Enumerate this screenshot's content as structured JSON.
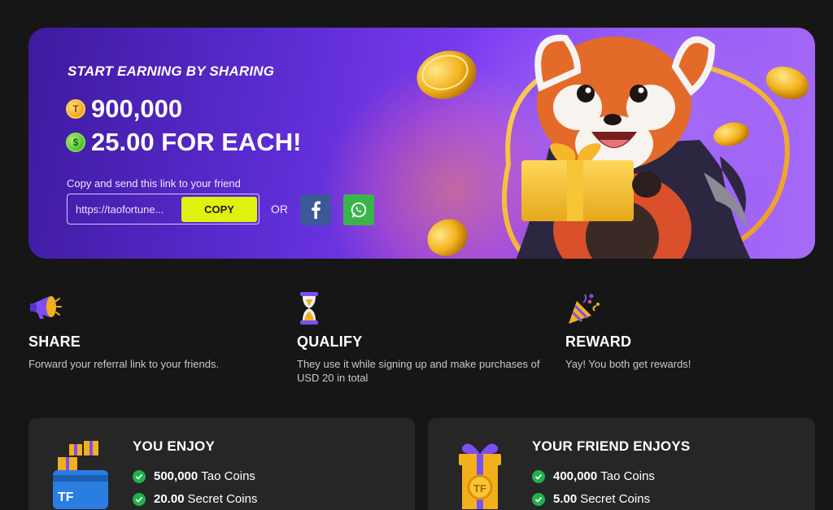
{
  "banner": {
    "title": "START EARNING BY SHARING",
    "amount_1": "900,000",
    "amount_2": "25.00 FOR EACH!",
    "coin_1_icon": "tao-coin-icon",
    "coin_2_icon": "secret-coin-icon",
    "copy_label": "Copy and send this link to your friend",
    "link_value": "https://taofortune...",
    "copy_button": "COPY",
    "or_text": "OR"
  },
  "steps": [
    {
      "title": "SHARE",
      "text": "Forward your referral link to your friends."
    },
    {
      "title": "QUALIFY",
      "text": "They use it while signing up and make purchases of USD 20 in total"
    },
    {
      "title": "REWARD",
      "text": "Yay! You both get rewards!"
    }
  ],
  "cards": [
    {
      "title": "YOU ENJOY",
      "items": [
        {
          "value": "500,000",
          "label": "Tao Coins"
        },
        {
          "value": "20.00",
          "label": "Secret Coins"
        }
      ]
    },
    {
      "title": "YOUR FRIEND ENJOYS",
      "items": [
        {
          "value": "400,000",
          "label": "Tao Coins"
        },
        {
          "value": "5.00",
          "label": "Secret Coins"
        }
      ]
    }
  ],
  "colors": {
    "accent": "#dff10f",
    "banner": "#6a34e0",
    "background": "#161616",
    "card": "#262626",
    "check": "#1fb24a"
  }
}
